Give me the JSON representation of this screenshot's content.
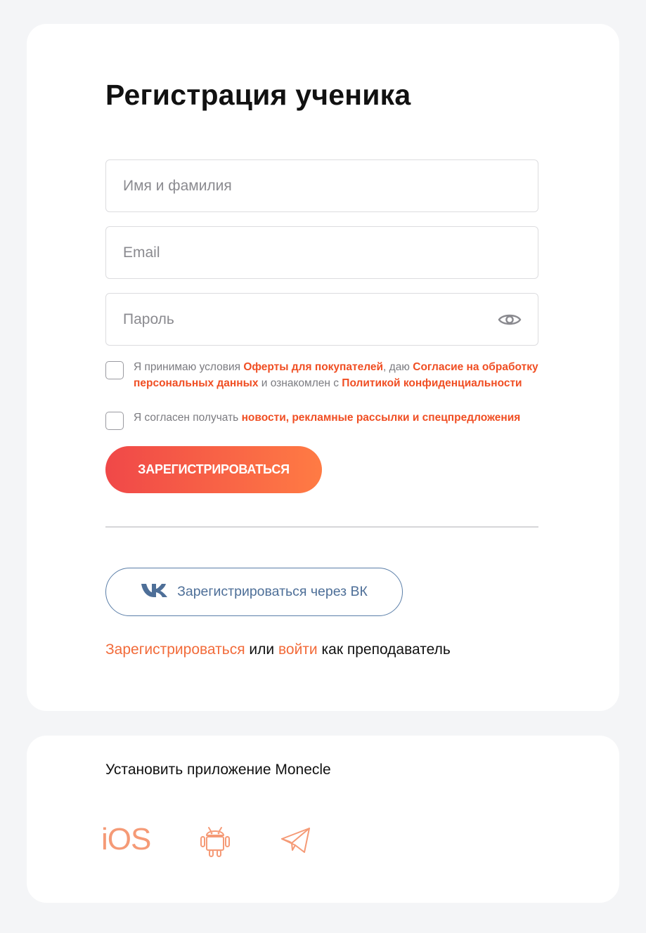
{
  "form": {
    "title": "Регистрация ученика",
    "name_placeholder": "Имя и фамилия",
    "email_placeholder": "Email",
    "password_placeholder": "Пароль",
    "password_toggle_icon": "eye-icon"
  },
  "consent": {
    "text_1": "Я принимаю условия ",
    "link_offer": "Оферты для покупателей",
    "text_2": ", даю ",
    "link_consent": "Согласие на обработку персональных данных",
    "text_3": " и ознакомлен с ",
    "link_policy": "Политикой конфиденциальности",
    "checked": false
  },
  "newsletter": {
    "text_1": "Я согласен получать ",
    "link": "новости, рекламные рассылки и спецпредложения",
    "checked": false
  },
  "buttons": {
    "register": "ЗАРЕГИСТРИРОВАТЬСЯ",
    "vk": "Зарегистрироваться через ВК"
  },
  "teacher": {
    "register_link": "Зарегистрироваться",
    "or": " или ",
    "login_link": "войти",
    "suffix": " как преподаватель"
  },
  "app": {
    "title": "Установить приложение Monecle",
    "ios_label": "iOS",
    "icons": [
      "ios-icon",
      "android-icon",
      "telegram-icon"
    ]
  },
  "colors": {
    "accent": "#f04e23",
    "gradient_start": "#f04848",
    "gradient_end": "#ff7b44",
    "vk": "#4e6f98",
    "app_icons": "#f59a76"
  }
}
